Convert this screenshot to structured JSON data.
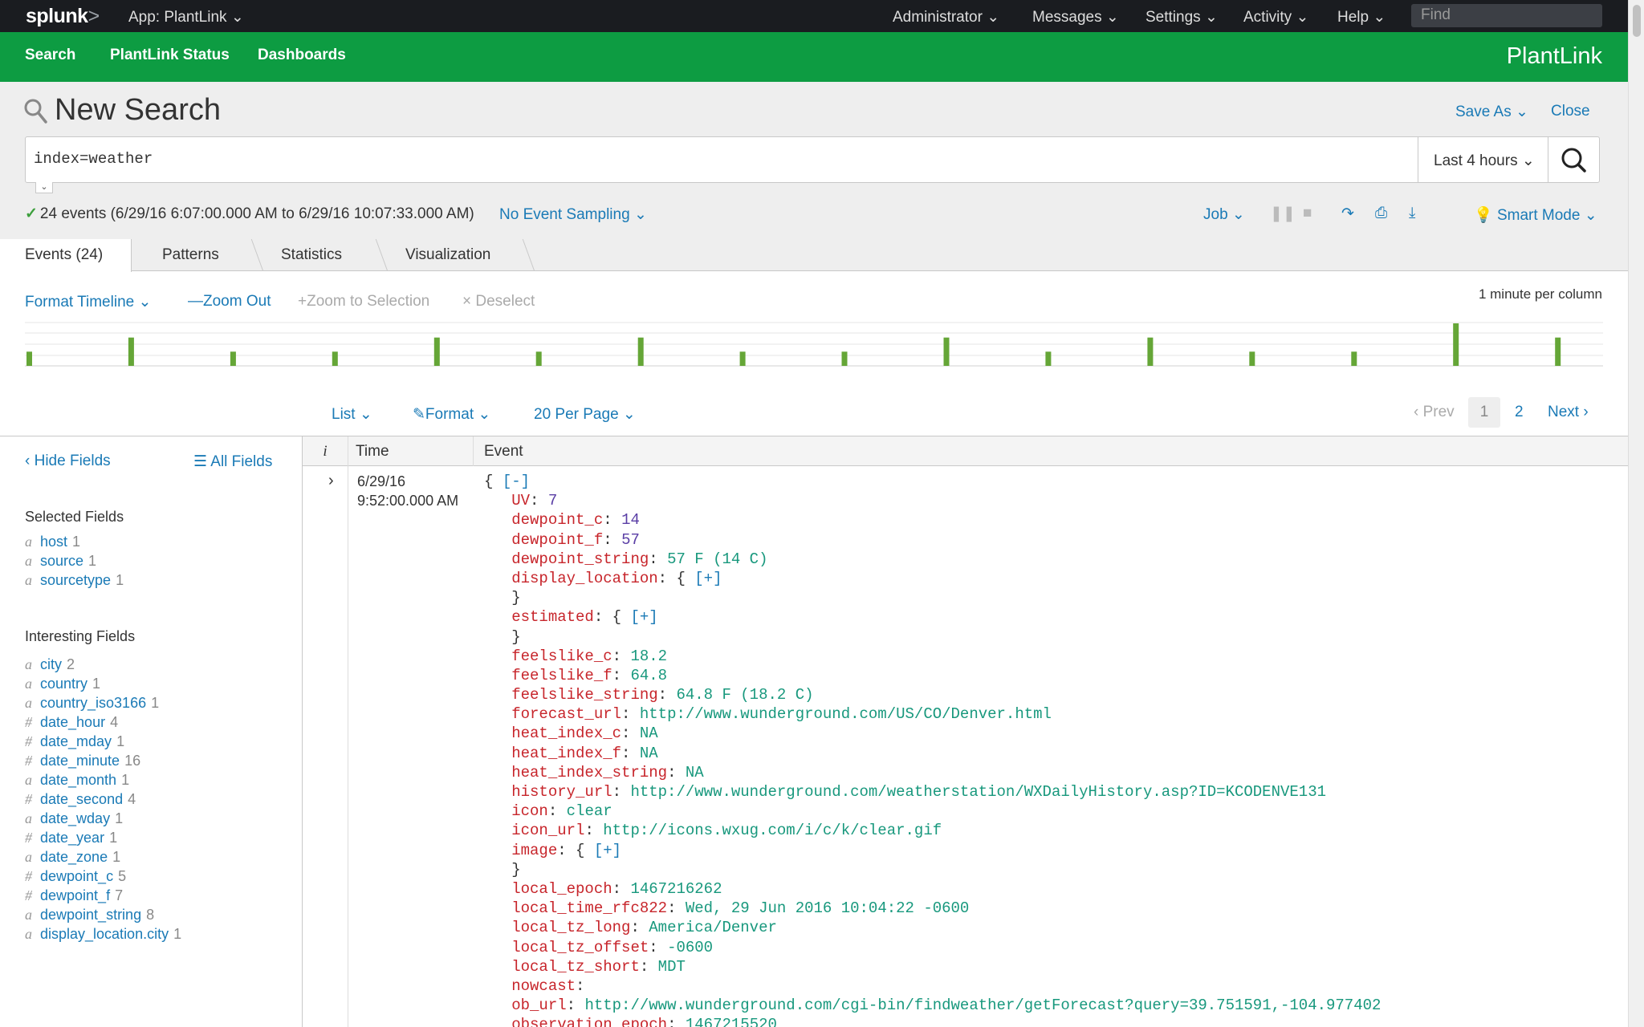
{
  "topbar": {
    "logo": "splunk",
    "logo_suffix": ">",
    "app_label": "App: PlantLink",
    "menus": [
      "Administrator",
      "Messages",
      "Settings",
      "Activity",
      "Help"
    ],
    "find_placeholder": "Find"
  },
  "nav": {
    "items": [
      "Search",
      "PlantLink Status",
      "Dashboards"
    ],
    "brand": "PlantLink"
  },
  "search": {
    "title": "New Search",
    "save_as": "Save As",
    "close": "Close",
    "query": "index=weather",
    "time_range": "Last 4 hours",
    "status": "24 events (6/29/16 6:07:00.000 AM to 6/29/16 10:07:33.000 AM)",
    "sampling": "No Event Sampling",
    "job": "Job",
    "mode": "Smart Mode"
  },
  "tabs": [
    "Events (24)",
    "Patterns",
    "Statistics",
    "Visualization"
  ],
  "timeline": {
    "format": "Format Timeline",
    "zoom_out": "Zoom Out",
    "zoom_selection": "Zoom to Selection",
    "deselect": "Deselect",
    "scale": "1 minute per column",
    "bars": [
      1,
      2,
      1,
      1,
      2,
      1,
      2,
      1,
      1,
      2,
      1,
      2,
      1,
      1,
      3,
      2
    ],
    "max": 3
  },
  "results_toolbar": {
    "list": "List",
    "format": "Format",
    "per_page": "20 Per Page",
    "prev": "Prev",
    "pages": [
      "1",
      "2"
    ],
    "next": "Next"
  },
  "sidebar": {
    "hide_fields": "Hide Fields",
    "all_fields": "All Fields",
    "selected_heading": "Selected Fields",
    "selected": [
      {
        "type": "a",
        "name": "host",
        "count": "1"
      },
      {
        "type": "a",
        "name": "source",
        "count": "1"
      },
      {
        "type": "a",
        "name": "sourcetype",
        "count": "1"
      }
    ],
    "interesting_heading": "Interesting Fields",
    "interesting": [
      {
        "type": "a",
        "name": "city",
        "count": "2"
      },
      {
        "type": "a",
        "name": "country",
        "count": "1"
      },
      {
        "type": "a",
        "name": "country_iso3166",
        "count": "1"
      },
      {
        "type": "#",
        "name": "date_hour",
        "count": "4"
      },
      {
        "type": "#",
        "name": "date_mday",
        "count": "1"
      },
      {
        "type": "#",
        "name": "date_minute",
        "count": "16"
      },
      {
        "type": "a",
        "name": "date_month",
        "count": "1"
      },
      {
        "type": "#",
        "name": "date_second",
        "count": "4"
      },
      {
        "type": "a",
        "name": "date_wday",
        "count": "1"
      },
      {
        "type": "#",
        "name": "date_year",
        "count": "1"
      },
      {
        "type": "a",
        "name": "date_zone",
        "count": "1"
      },
      {
        "type": "#",
        "name": "dewpoint_c",
        "count": "5"
      },
      {
        "type": "#",
        "name": "dewpoint_f",
        "count": "7"
      },
      {
        "type": "a",
        "name": "dewpoint_string",
        "count": "8"
      },
      {
        "type": "a",
        "name": "display_location.city",
        "count": "1"
      }
    ]
  },
  "results": {
    "col_i": "i",
    "col_time": "Time",
    "col_event": "Event",
    "time_date": "6/29/16",
    "time_clock": "9:52:00.000 AM",
    "event_lines": [
      {
        "indent": "",
        "key": "",
        "value": "",
        "brace": "{ ",
        "link": "[-]"
      },
      {
        "indent": "   ",
        "key": "UV",
        "value": "7",
        "vtype": "n"
      },
      {
        "indent": "   ",
        "key": "dewpoint_c",
        "value": "14",
        "vtype": "n"
      },
      {
        "indent": "   ",
        "key": "dewpoint_f",
        "value": "57",
        "vtype": "n"
      },
      {
        "indent": "   ",
        "key": "dewpoint_string",
        "value": "57 F (14 C)",
        "vtype": "s"
      },
      {
        "indent": "   ",
        "key": "display_location",
        "value": "",
        "brace": "{ ",
        "link": "[+]"
      },
      {
        "indent": "   ",
        "key": "",
        "value": "",
        "brace": "}"
      },
      {
        "indent": "   ",
        "key": "estimated",
        "value": "",
        "brace": "{ ",
        "link": "[+]"
      },
      {
        "indent": "   ",
        "key": "",
        "value": "",
        "brace": "}"
      },
      {
        "indent": "   ",
        "key": "feelslike_c",
        "value": "18.2",
        "vtype": "s"
      },
      {
        "indent": "   ",
        "key": "feelslike_f",
        "value": "64.8",
        "vtype": "s"
      },
      {
        "indent": "   ",
        "key": "feelslike_string",
        "value": "64.8 F (18.2 C)",
        "vtype": "s"
      },
      {
        "indent": "   ",
        "key": "forecast_url",
        "value": "http://www.wunderground.com/US/CO/Denver.html",
        "vtype": "s"
      },
      {
        "indent": "   ",
        "key": "heat_index_c",
        "value": "NA",
        "vtype": "s"
      },
      {
        "indent": "   ",
        "key": "heat_index_f",
        "value": "NA",
        "vtype": "s"
      },
      {
        "indent": "   ",
        "key": "heat_index_string",
        "value": "NA",
        "vtype": "s"
      },
      {
        "indent": "   ",
        "key": "history_url",
        "value": "http://www.wunderground.com/weatherstation/WXDailyHistory.asp?ID=KCODENVE131",
        "vtype": "s"
      },
      {
        "indent": "   ",
        "key": "icon",
        "value": "clear",
        "vtype": "s"
      },
      {
        "indent": "   ",
        "key": "icon_url",
        "value": "http://icons.wxug.com/i/c/k/clear.gif",
        "vtype": "s"
      },
      {
        "indent": "   ",
        "key": "image",
        "value": "",
        "brace": "{ ",
        "link": "[+]"
      },
      {
        "indent": "   ",
        "key": "",
        "value": "",
        "brace": "}"
      },
      {
        "indent": "   ",
        "key": "local_epoch",
        "value": "1467216262",
        "vtype": "s"
      },
      {
        "indent": "   ",
        "key": "local_time_rfc822",
        "value": "Wed, 29 Jun 2016 10:04:22 -0600",
        "vtype": "s"
      },
      {
        "indent": "   ",
        "key": "local_tz_long",
        "value": "America/Denver",
        "vtype": "s"
      },
      {
        "indent": "   ",
        "key": "local_tz_offset",
        "value": "-0600",
        "vtype": "s"
      },
      {
        "indent": "   ",
        "key": "local_tz_short",
        "value": "MDT",
        "vtype": "s"
      },
      {
        "indent": "   ",
        "key": "nowcast",
        "value": "",
        "vtype": "s"
      },
      {
        "indent": "   ",
        "key": "ob_url",
        "value": "http://www.wunderground.com/cgi-bin/findweather/getForecast?query=39.751591,-104.977402",
        "vtype": "s"
      },
      {
        "indent": "   ",
        "key": "observation_epoch",
        "value": "1467215520",
        "vtype": "s"
      }
    ]
  },
  "colors": {
    "topbar": "#1a1c20",
    "nav": "#0d9c42",
    "link": "#1a7ab6",
    "key": "#c7252b",
    "value": "#18987d",
    "bar": "#65a637"
  }
}
